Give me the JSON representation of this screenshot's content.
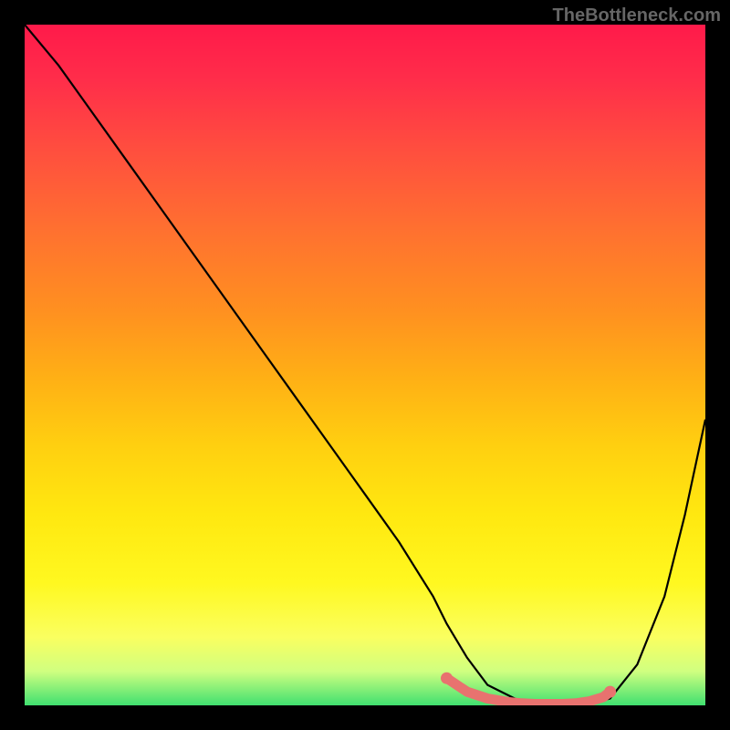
{
  "watermark": "TheBottleneck.com",
  "chart_data": {
    "type": "line",
    "title": "",
    "xlabel": "",
    "ylabel": "",
    "xlim": [
      0,
      100
    ],
    "ylim": [
      0,
      100
    ],
    "series": [
      {
        "name": "bottleneck-curve",
        "x": [
          0,
          5,
          10,
          15,
          20,
          25,
          30,
          35,
          40,
          45,
          50,
          55,
          60,
          62,
          65,
          68,
          72,
          75,
          78,
          82,
          86,
          90,
          94,
          97,
          100
        ],
        "y": [
          100,
          94,
          87,
          80,
          73,
          66,
          59,
          52,
          45,
          38,
          31,
          24,
          16,
          12,
          7,
          3,
          1,
          0,
          0,
          0,
          1,
          6,
          16,
          28,
          42
        ]
      },
      {
        "name": "flat-highlight",
        "x": [
          62,
          65,
          68,
          71,
          73,
          75,
          77,
          79,
          81,
          83,
          85,
          86
        ],
        "y": [
          4,
          2,
          1,
          0.5,
          0.3,
          0.2,
          0.2,
          0.2,
          0.3,
          0.6,
          1.2,
          2
        ]
      }
    ],
    "background_gradient": {
      "top": "#ff1a4a",
      "mid": "#ffd010",
      "bottom": "#40e070"
    },
    "highlight_color": "#e8726f",
    "curve_color": "#000000"
  }
}
